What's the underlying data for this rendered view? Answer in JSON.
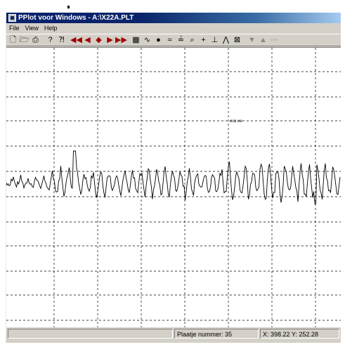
{
  "window": {
    "title": "PPlot voor Windows - A:\\X22A.PLT"
  },
  "menu": [
    "File",
    "View",
    "Help"
  ],
  "toolbar": {
    "icons": [
      "new-icon",
      "open-icon",
      "print-icon",
      "help-icon",
      "context-help-icon",
      "first-icon",
      "prev-icon",
      "step-icon",
      "next-icon",
      "last-icon",
      "grid-icon",
      "wave-icon",
      "filter-icon",
      "smooth-icon",
      "scale-icon",
      "zoom-icon",
      "crosshair-icon",
      "marker-icon",
      "peak-icon",
      "fit-icon",
      "arrow-down-icon",
      "arrow-up-icon",
      "more-icon"
    ]
  },
  "plot": {
    "annotation": "ecc ee"
  },
  "status": {
    "plate": "Plaatje nummer: 35",
    "coords": "X: 398.22 Y: 252.28"
  }
}
